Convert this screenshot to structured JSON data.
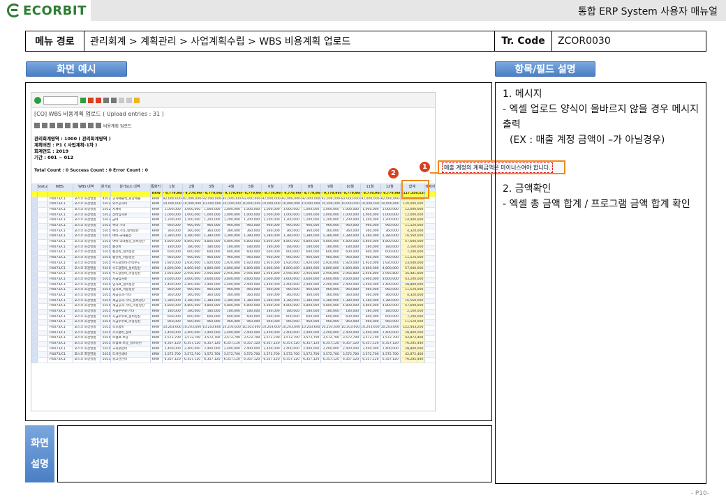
{
  "brand": {
    "logo_text": "ECORBIT"
  },
  "header": {
    "title": "통합 ERP System 사용자 매뉴얼"
  },
  "menu_path": {
    "label": "메뉴 경로",
    "value": "관리회계 > 계획관리 > 사업계획수립 > WBS 비용계획 업로드",
    "tr_label": "Tr. Code",
    "tr_value": "ZCOR0030"
  },
  "sections": {
    "screen_example": "화면 예시",
    "field_desc": "항목/필드 설명",
    "screen_expl_1": "화면",
    "screen_expl_2": "설명"
  },
  "description": {
    "item1_title": "1.  메시지",
    "item1_text": " - 엑셀 업로드 양식이 올바르지 않을 경우 메시지 출력",
    "item1_ex": "(EX : 매출 계정 금액이 –가 아닐경우)",
    "item2_title": "2. 금액확인",
    "item2_text": " - 엑셀 총 금액 합계 / 프로그램 금액 합계 확인"
  },
  "sap": {
    "title": "[CO] WBS 비용계획 업로드 ( Upload entries : 31 )",
    "toolbar2_label": "비용계획 업로드",
    "params": [
      "관리회계영역 : 1000 (        관리회계영역 )",
      "계획버전 : P1 ( 사업계획-1차 )",
      "회계연도 : 2019",
      "기간 : 001 ~ 012"
    ],
    "count_line": "Total Count : 0 Success Count : 0 Error Count : 0",
    "columns": [
      "Status",
      "WBS",
      "WBS 내역",
      "원가요소",
      "원가요소 내역",
      "통화키",
      "1월",
      "2월",
      "3월",
      "4월",
      "5월",
      "6월",
      "7월",
      "8월",
      "9월",
      "10월",
      "11월",
      "12월",
      "합계",
      "메세지"
    ],
    "total_row": {
      "currency": "KRW",
      "month": "- 9,779,960 -",
      "sum": "- 117,359,520"
    },
    "rows": [
      {
        "wbs": "P.0073/C1",
        "desc": "포스코 회장영홈",
        "ce": "401201001",
        "ced": "공사매출액_회장매출",
        "m": "92,000,000-",
        "sum": "1,104,000,000"
      },
      {
        "wbs": "P.0073/C1",
        "desc": "포스코 회장영홈",
        "ce": "501201001",
        "ced": "외주공사비",
        "m": "10,000,000",
        "sum": "120,000,000"
      },
      {
        "wbs": "P.0073/C1",
        "desc": "포스코 회장영홈",
        "ce": "501203001",
        "ced": "자재비",
        "m": "1,000,000",
        "sum": "12,000,000"
      },
      {
        "wbs": "P.0073/C1",
        "desc": "포스코 회장영홈",
        "ce": "501207001",
        "ced": "장비임차료",
        "m": "1,000,000",
        "sum": "12,000,000"
      },
      {
        "wbs": "P.0073/C1",
        "desc": "포스코 회장영홈",
        "ce": "501301001",
        "ced": "급여",
        "m": "1,200,000",
        "sum": "14,400,000"
      },
      {
        "wbs": "P.0073/C1",
        "desc": "포스코 회장영홈",
        "ce": "501501097",
        "ced": "복리-기타",
        "m": "960,000",
        "sum": "11,520,000"
      },
      {
        "wbs": "P.0073/C1",
        "desc": "포스코 회장영홈",
        "ce": "501501098",
        "ced": "복리-기타_실비정산",
        "m": "360,000",
        "sum": "4,320,000"
      },
      {
        "wbs": "P.0073/C1",
        "desc": "포스코 회장영홈",
        "ce": "501502001",
        "ced": "여비-국내출장",
        "m": "1,380,000",
        "sum": "16,560,000"
      },
      {
        "wbs": "P.0073/C1",
        "desc": "포스코 회장영홈",
        "ce": "501502002",
        "ced": "여비-국내출장_실비정산",
        "m": "4,800,000",
        "sum": "57,600,000"
      },
      {
        "wbs": "P.0073/C1",
        "desc": "포스코 회장영홈",
        "ce": "501504001",
        "ced": "통신비",
        "m": "180,000",
        "sum": "2,160,000"
      },
      {
        "wbs": "P.0073/C1",
        "desc": "포스코 회장영홈",
        "ce": "501504002",
        "ced": "통신비_실비정산",
        "m": "600,000",
        "sum": "7,200,000"
      },
      {
        "wbs": "P.0073/C1",
        "desc": "포스코 회장영홈",
        "ce": "501504003",
        "ced": "통신비_이용정산",
        "m": "960,000",
        "sum": "11,520,000"
      },
      {
        "wbs": "P.0073/C1",
        "desc": "포스코 회장영홈",
        "ce": "501505001",
        "ced": "수도광열비-전력수도",
        "m": "1,920,000",
        "sum": "23,040,000"
      },
      {
        "wbs": "P.0073/C1",
        "desc": "포스코 회장영홈",
        "ce": "501505002",
        "ced": "수도광열비_실비정산",
        "m": "4,800,000",
        "sum": "57,600,000"
      },
      {
        "wbs": "P.0073/C1",
        "desc": "포스코 회장영홈",
        "ce": "501505003",
        "ced": "수도광열비_이용정산",
        "m": "2,956,800",
        "sum": "35,481,600"
      },
      {
        "wbs": "P.0073/C1",
        "desc": "포스코 회장영홈",
        "ce": "501506001",
        "ced": "지급임차료",
        "m": "3,600,000",
        "sum": "43,200,000"
      },
      {
        "wbs": "P.0073/C1",
        "desc": "포스코 회장영홈",
        "ce": "501506002",
        "ced": "임차료_실비정산",
        "m": "2,400,000",
        "sum": "28,800,000"
      },
      {
        "wbs": "P.0073/C1",
        "desc": "포스코 회장영홈",
        "ce": "501506003",
        "ced": "임차료_이용정산",
        "m": "960,000",
        "sum": "11,520,000"
      },
      {
        "wbs": "P.0073/C1",
        "desc": "포스코 회장영홈",
        "ce": "501507097",
        "ced": "세금공과-기타",
        "m": "360,000",
        "sum": "4,320,000"
      },
      {
        "wbs": "P.0073/C1",
        "desc": "포스코 회장영홈",
        "ce": "501507098",
        "ced": "세금공과-기타_실비정산",
        "m": "1,380,000",
        "sum": "16,560,000"
      },
      {
        "wbs": "P.0073/C1",
        "desc": "포스코 회장영홈",
        "ce": "501507099",
        "ced": "세금공과-기타_이용정산",
        "m": "4,800,000",
        "sum": "57,600,000"
      },
      {
        "wbs": "P.0073/C1",
        "desc": "포스코 회장영홈",
        "ce": "501510007",
        "ced": "지급수수료-기타",
        "m": "180,000",
        "sum": "2,160,000"
      },
      {
        "wbs": "P.0073/C1",
        "desc": "포스코 회장영홈",
        "ce": "501510098",
        "ced": "지급수수료_실비정산",
        "m": "600,000",
        "sum": "7,200,000"
      },
      {
        "wbs": "P.0073/C1",
        "desc": "포스코 회장영홈",
        "ce": "501510099",
        "ced": "지급수수료_이용정산",
        "m": "960,000",
        "sum": "11,520,000"
      },
      {
        "wbs": "P.0073/C1",
        "desc": "포스코 회장영홈",
        "ce": "501526004",
        "ced": "소모품비",
        "m": "10,203,600",
        "sum": "122,443,200"
      },
      {
        "wbs": "P.0073/C1",
        "desc": "포스코 회장영홈",
        "ce": "501526005",
        "ced": "소모품비_실비",
        "m": "2,400,000",
        "sum": "28,800,000"
      },
      {
        "wbs": "P.0073/C1",
        "desc": "포스코 회장영홈",
        "ce": "501527002",
        "ced": "보험료-보증",
        "m": "3,572,700",
        "sum": "42,872,400"
      },
      {
        "wbs": "P.0073/C1",
        "desc": "포스코 회장영홈",
        "ce": "501527003",
        "ced": "보험료-보증_실비정산",
        "m": "6,357,120",
        "sum": "76,285,440"
      },
      {
        "wbs": "P.0073/C1",
        "desc": "포스코 회장영홈",
        "ce": "501527004",
        "ced": "교육훈련비",
        "m": "2,400,000",
        "sum": "28,800,000"
      },
      {
        "wbs": "P.0073/C1",
        "desc": "포스코 회장영홈",
        "ce": "501529001",
        "ced": "도서인쇄비",
        "m": "3,572,700",
        "sum": "42,872,400"
      },
      {
        "wbs": "P.0073/C1",
        "desc": "포스코 회장영홈",
        "ce": "501531001",
        "ced": "광고선전비",
        "m": "6,357,120",
        "sum": "76,285,440"
      }
    ],
    "message": "매출 계정의 계획금액은 마이너스여야 합니다.",
    "badge1": "1",
    "badge2": "2"
  },
  "page_number": "- P10-"
}
